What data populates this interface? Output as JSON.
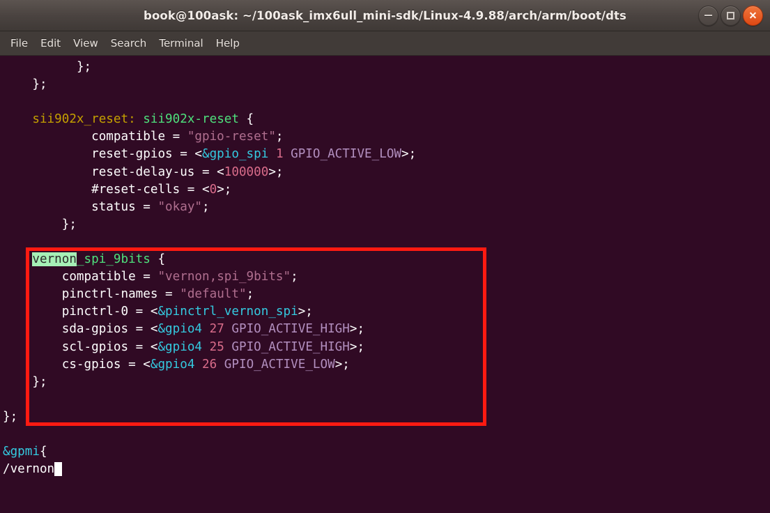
{
  "window": {
    "title": "book@100ask: ~/100ask_imx6ull_mini-sdk/Linux-4.9.88/arch/arm/boot/dts",
    "controls": {
      "minimize": "minimize",
      "maximize": "maximize",
      "close": "close"
    }
  },
  "menubar": {
    "items": [
      {
        "label": "File"
      },
      {
        "label": "Edit"
      },
      {
        "label": "View"
      },
      {
        "label": "Search"
      },
      {
        "label": "Terminal"
      },
      {
        "label": "Help"
      }
    ]
  },
  "terminal": {
    "colors": {
      "background": "#300a24",
      "foreground": "#ffffff",
      "label": "#c4a000",
      "node_name": "#4ee07c",
      "string": "#b06f8f",
      "phandle": "#34cae0",
      "number": "#d96c8a",
      "macro": "#b28fbf",
      "search_highlight_bg": "#a6f0b6",
      "cursor": "#ffffff",
      "annotation_box": "#ff1a11"
    },
    "editor": "vim",
    "search_term": "vernon",
    "lines": [
      {
        "id": "l1",
        "indent": 10,
        "segments": [
          {
            "t": "};",
            "c": "c-white"
          }
        ]
      },
      {
        "id": "l2",
        "indent": 4,
        "segments": [
          {
            "t": "};",
            "c": "c-white"
          }
        ]
      },
      {
        "id": "l3",
        "indent": 0,
        "segments": []
      },
      {
        "id": "l4",
        "indent": 4,
        "segments": [
          {
            "t": "sii902x_reset:",
            "c": "c-label"
          },
          {
            "t": " ",
            "c": "c-white"
          },
          {
            "t": "sii902x-reset",
            "c": "c-node"
          },
          {
            "t": " {",
            "c": "c-white"
          }
        ]
      },
      {
        "id": "l5",
        "indent": 12,
        "segments": [
          {
            "t": "compatible = ",
            "c": "c-prop"
          },
          {
            "t": "\"gpio-reset\"",
            "c": "c-string"
          },
          {
            "t": ";",
            "c": "c-white"
          }
        ]
      },
      {
        "id": "l6",
        "indent": 12,
        "segments": [
          {
            "t": "reset-gpios = <",
            "c": "c-prop"
          },
          {
            "t": "&gpio_spi",
            "c": "c-phandle"
          },
          {
            "t": " ",
            "c": "c-white"
          },
          {
            "t": "1",
            "c": "c-number"
          },
          {
            "t": " ",
            "c": "c-white"
          },
          {
            "t": "GPIO_ACTIVE_LOW",
            "c": "c-macro"
          },
          {
            "t": ">;",
            "c": "c-white"
          }
        ]
      },
      {
        "id": "l7",
        "indent": 12,
        "segments": [
          {
            "t": "reset-delay-us = <",
            "c": "c-prop"
          },
          {
            "t": "100000",
            "c": "c-number"
          },
          {
            "t": ">;",
            "c": "c-white"
          }
        ]
      },
      {
        "id": "l8",
        "indent": 12,
        "segments": [
          {
            "t": "#reset-cells = <",
            "c": "c-prop"
          },
          {
            "t": "0",
            "c": "c-number"
          },
          {
            "t": ">;",
            "c": "c-white"
          }
        ]
      },
      {
        "id": "l9",
        "indent": 12,
        "segments": [
          {
            "t": "status = ",
            "c": "c-prop"
          },
          {
            "t": "\"okay\"",
            "c": "c-string"
          },
          {
            "t": ";",
            "c": "c-white"
          }
        ]
      },
      {
        "id": "l10",
        "indent": 8,
        "segments": [
          {
            "t": "};",
            "c": "c-white"
          }
        ]
      },
      {
        "id": "l11",
        "indent": 0,
        "segments": []
      },
      {
        "id": "l12",
        "indent": 4,
        "segments": [
          {
            "t": "vernon",
            "c": "search-hit"
          },
          {
            "t": "_spi_9bits",
            "c": "c-node"
          },
          {
            "t": " {",
            "c": "c-white"
          }
        ]
      },
      {
        "id": "l13",
        "indent": 8,
        "segments": [
          {
            "t": "compatible = ",
            "c": "c-prop"
          },
          {
            "t": "\"vernon,spi_9bits\"",
            "c": "c-string"
          },
          {
            "t": ";",
            "c": "c-white"
          }
        ]
      },
      {
        "id": "l14",
        "indent": 8,
        "segments": [
          {
            "t": "pinctrl-names = ",
            "c": "c-prop"
          },
          {
            "t": "\"default\"",
            "c": "c-string"
          },
          {
            "t": ";",
            "c": "c-white"
          }
        ]
      },
      {
        "id": "l15",
        "indent": 8,
        "segments": [
          {
            "t": "pinctrl-0 = <",
            "c": "c-prop"
          },
          {
            "t": "&pinctrl_vernon_spi",
            "c": "c-phandle"
          },
          {
            "t": ">;",
            "c": "c-white"
          }
        ]
      },
      {
        "id": "l16",
        "indent": 8,
        "segments": [
          {
            "t": "sda-gpios = <",
            "c": "c-prop"
          },
          {
            "t": "&gpio4",
            "c": "c-phandle"
          },
          {
            "t": " ",
            "c": "c-white"
          },
          {
            "t": "27",
            "c": "c-number"
          },
          {
            "t": " ",
            "c": "c-white"
          },
          {
            "t": "GPIO_ACTIVE_HIGH",
            "c": "c-macro"
          },
          {
            "t": ">;",
            "c": "c-white"
          }
        ]
      },
      {
        "id": "l17",
        "indent": 8,
        "segments": [
          {
            "t": "scl-gpios = <",
            "c": "c-prop"
          },
          {
            "t": "&gpio4",
            "c": "c-phandle"
          },
          {
            "t": " ",
            "c": "c-white"
          },
          {
            "t": "25",
            "c": "c-number"
          },
          {
            "t": " ",
            "c": "c-white"
          },
          {
            "t": "GPIO_ACTIVE_HIGH",
            "c": "c-macro"
          },
          {
            "t": ">;",
            "c": "c-white"
          }
        ]
      },
      {
        "id": "l18",
        "indent": 8,
        "segments": [
          {
            "t": "cs-gpios = <",
            "c": "c-prop"
          },
          {
            "t": "&gpio4",
            "c": "c-phandle"
          },
          {
            "t": " ",
            "c": "c-white"
          },
          {
            "t": "26",
            "c": "c-number"
          },
          {
            "t": " ",
            "c": "c-white"
          },
          {
            "t": "GPIO_ACTIVE_LOW",
            "c": "c-macro"
          },
          {
            "t": ">;",
            "c": "c-white"
          }
        ]
      },
      {
        "id": "l19",
        "indent": 4,
        "segments": [
          {
            "t": "};",
            "c": "c-white"
          }
        ]
      },
      {
        "id": "l20",
        "indent": 0,
        "segments": []
      },
      {
        "id": "l21",
        "indent": 0,
        "segments": [
          {
            "t": "};",
            "c": "c-white"
          }
        ]
      },
      {
        "id": "l22",
        "indent": 0,
        "segments": []
      },
      {
        "id": "l23",
        "indent": 0,
        "segments": [
          {
            "t": "&gpmi",
            "c": "c-ref"
          },
          {
            "t": "{",
            "c": "c-white"
          }
        ]
      },
      {
        "id": "l24",
        "indent": 0,
        "segments": [
          {
            "t": "/vernon",
            "c": "c-white"
          },
          {
            "t": " ",
            "c": "cursor-block"
          }
        ]
      }
    ]
  }
}
